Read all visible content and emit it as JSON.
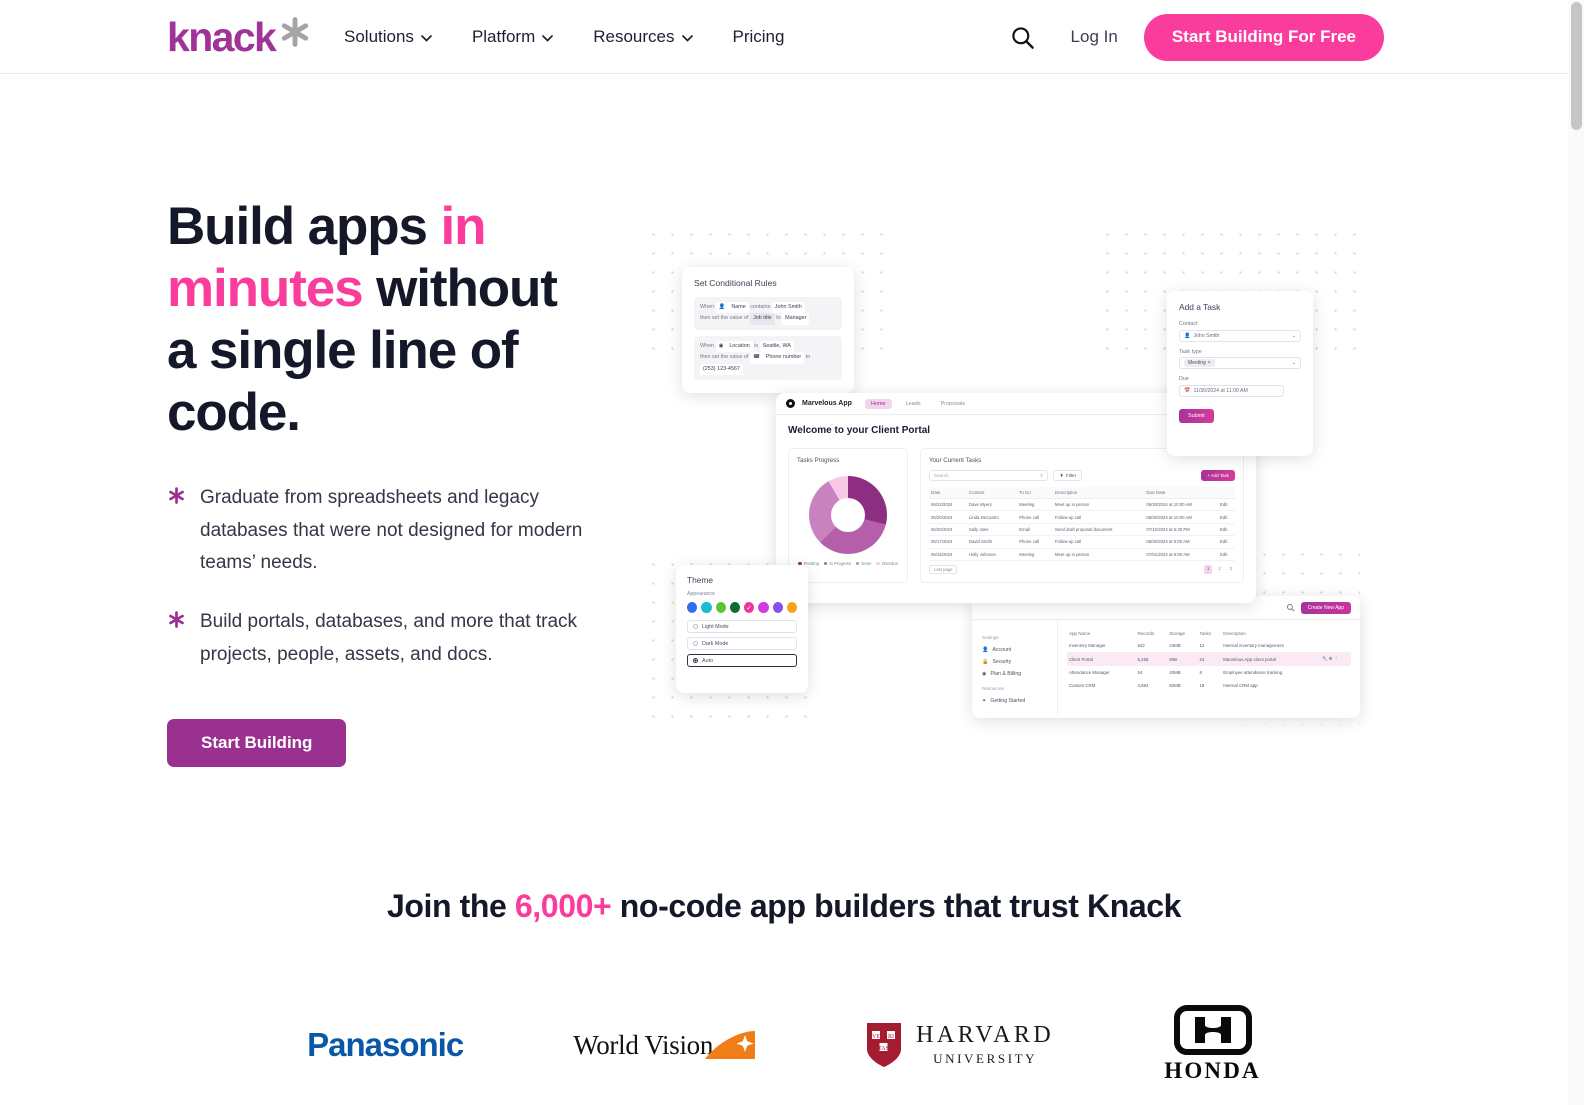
{
  "header": {
    "logo_text": "knack",
    "logo_icon": "asterisk-icon",
    "nav": [
      {
        "label": "Solutions",
        "has_dropdown": true
      },
      {
        "label": "Platform",
        "has_dropdown": true
      },
      {
        "label": "Resources",
        "has_dropdown": true
      },
      {
        "label": "Pricing",
        "has_dropdown": false
      }
    ],
    "search_icon": "search-icon",
    "login_label": "Log In",
    "cta_label": "Start Building For Free"
  },
  "hero": {
    "headline_parts": [
      {
        "text": "Build apps ",
        "accent": false
      },
      {
        "text": "in minutes",
        "accent": true
      },
      {
        "text": " without a single line of code.",
        "accent": false
      }
    ],
    "bullets": [
      "Graduate from spreadsheets and legacy databases that were not designed for modern teams’ needs.",
      "Build portals, databases, and more that track projects, people, assets, and docs."
    ],
    "cta_label": "Start Building"
  },
  "art": {
    "conditional_rules": {
      "title": "Set Conditional Rules",
      "rules": [
        {
          "line1": [
            "When",
            "Name",
            "contains",
            "John Smith"
          ],
          "line2": [
            "then set the value of",
            "Job title",
            "to",
            "Manager"
          ]
        },
        {
          "line1": [
            "When",
            "Location",
            "is",
            "Seattle, WA"
          ],
          "line2": [
            "then set the value of",
            "Phone number",
            "to",
            "(253) 123-4567"
          ]
        }
      ]
    },
    "add_task": {
      "title": "Add a Task",
      "fields": [
        {
          "label": "Contact",
          "value": "John Smith",
          "icon": "person-icon"
        },
        {
          "label": "Task type",
          "value": "Meeting",
          "icon": "tag-icon"
        },
        {
          "label": "Due",
          "value": "11/30/2024 at 11:00 AM",
          "icon": "calendar-icon"
        }
      ],
      "submit_label": "Submit"
    },
    "portal": {
      "app_name": "Marvelous App",
      "tabs": [
        "Home",
        "Leads",
        "Proposals"
      ],
      "active_tab": "Home",
      "welcome": "Welcome to your Client Portal",
      "progress_title": "Tasks Progress",
      "tasks_title": "Your Current Tasks",
      "search_placeholder": "Search",
      "filter_label": "Filter",
      "add_task_label": "+ Add Task",
      "columns": [
        "Date",
        "Contact",
        "To Do",
        "Description",
        "Due Date",
        ""
      ],
      "rows": [
        {
          "date": "06/22/2024",
          "contact": "Dave Myers",
          "todo": "Meeting",
          "desc": "Meet up in person",
          "due": "06/30/2024 at 10:00 AM",
          "action": "Edit"
        },
        {
          "date": "06/20/2024",
          "contact": "Linda DeCastro",
          "todo": "Phone call",
          "desc": "Follow-up call",
          "due": "06/30/2024 at 10:00 AM",
          "action": "Edit"
        },
        {
          "date": "06/20/2024",
          "contact": "Sally Jane",
          "todo": "Email",
          "desc": "Send draft proposal document",
          "due": "07/10/2024 at 5:30 PM",
          "action": "Edit"
        },
        {
          "date": "06/17/2024",
          "contact": "David Smith",
          "todo": "Phone call",
          "desc": "Follow-up call",
          "due": "06/30/2024 at 9:00 AM",
          "action": "Edit"
        },
        {
          "date": "06/15/2024",
          "contact": "Holly Johnson",
          "todo": "Meeting",
          "desc": "Meet up in person",
          "due": "07/01/2024 at 9:00 AM",
          "action": "Edit"
        }
      ],
      "pagination": [
        "1",
        "2",
        "3"
      ],
      "page_size_label": "Last page"
    },
    "theme": {
      "title": "Theme",
      "appearance_label": "Appearance",
      "swatches": [
        "#2d6ff0",
        "#19bcd4",
        "#5dc335",
        "#0d6b33",
        "#f0349a",
        "#d03ce0",
        "#8a4ef0",
        "#f5a312"
      ],
      "selected_swatch_index": 4,
      "modes": [
        "Light Mode",
        "Dark Mode",
        "Auto"
      ],
      "selected_mode": "Auto"
    },
    "apps_dashboard": {
      "create_app_label": "Create New App",
      "sidebar_sections": [
        {
          "label": "Settings",
          "items": [
            {
              "label": "Account",
              "icon": "person-icon"
            },
            {
              "label": "Security",
              "icon": "lock-icon"
            },
            {
              "label": "Plan & Billing",
              "icon": "billing-icon"
            }
          ]
        },
        {
          "label": "Resources",
          "items": [
            {
              "label": "Getting Started",
              "icon": "rocket-icon"
            }
          ]
        }
      ],
      "columns": [
        "App Name",
        "Records",
        "Storage",
        "Tasks",
        "Description"
      ],
      "rows": [
        {
          "name": "Inventory Manager",
          "records": "642",
          "storage": "23MB",
          "tasks": "12",
          "desc": "Internal inventory management",
          "highlighted": false
        },
        {
          "name": "Client Portal",
          "records": "5,268",
          "storage": "90B",
          "tasks": "24",
          "desc": "Marvelous App client portal",
          "highlighted": true
        },
        {
          "name": "Attendance Manager",
          "records": "54",
          "storage": "40MB",
          "tasks": "8",
          "desc": "Employee attendance tracking",
          "highlighted": false
        },
        {
          "name": "Custom CRM",
          "records": "4,884",
          "storage": "82MB",
          "tasks": "18",
          "desc": "Internal CRM app",
          "highlighted": false
        }
      ]
    }
  },
  "chart_data": {
    "type": "pie",
    "title": "Tasks Progress",
    "categories": [
      "Pending",
      "In Progress",
      "Done",
      "Overdue"
    ],
    "values": [
      29,
      34,
      29,
      8
    ],
    "colors": [
      "#8e2e83",
      "#b55fab",
      "#c982bf",
      "#f7c9e6"
    ],
    "legend_position": "bottom",
    "xlabel": "",
    "ylabel": ""
  },
  "social_proof": {
    "heading_pre": "Join the ",
    "heading_accent": "6,000+",
    "heading_post": " no-code app builders that trust Knack",
    "logos": [
      {
        "name": "Panasonic",
        "text": "Panasonic"
      },
      {
        "name": "World Vision",
        "text": "World Vision"
      },
      {
        "name": "Harvard University",
        "text": "HARVARD",
        "subtext": "UNIVERSITY"
      },
      {
        "name": "Honda",
        "text": "HONDA"
      }
    ]
  },
  "colors": {
    "accent_pink": "#fa3c9c",
    "brand_purple": "#9a3190",
    "text_dark": "#141828"
  }
}
